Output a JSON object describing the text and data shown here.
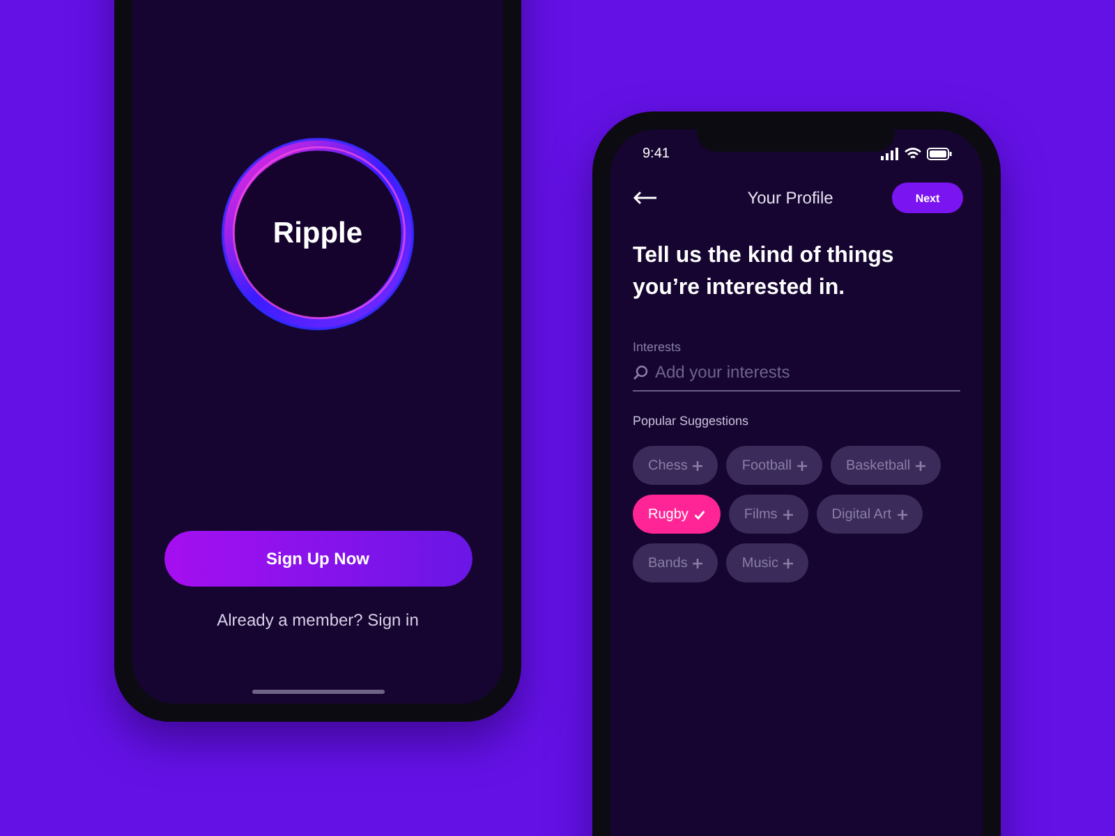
{
  "welcome_screen": {
    "logo": "Ripple",
    "primary_button": "Sign Up Now",
    "sign_in_prompt": "Already a member? Sign in"
  },
  "profile_screen": {
    "status_bar": {
      "time": "9:41"
    },
    "title": "Your Profile",
    "next_button": "Next",
    "heading": "Tell us the kind of things you’re interested in.",
    "interests_label": "Interests",
    "search": {
      "placeholder": "Add your interests"
    },
    "suggestions_label": "Popular Suggestions",
    "chips": [
      {
        "label": "Chess",
        "selected": false
      },
      {
        "label": "Football",
        "selected": false
      },
      {
        "label": "Basketball",
        "selected": false
      },
      {
        "label": "Rugby",
        "selected": true
      },
      {
        "label": "Films",
        "selected": false
      },
      {
        "label": "Digital Art",
        "selected": false
      },
      {
        "label": "Bands",
        "selected": false
      },
      {
        "label": "Music",
        "selected": false
      }
    ]
  }
}
